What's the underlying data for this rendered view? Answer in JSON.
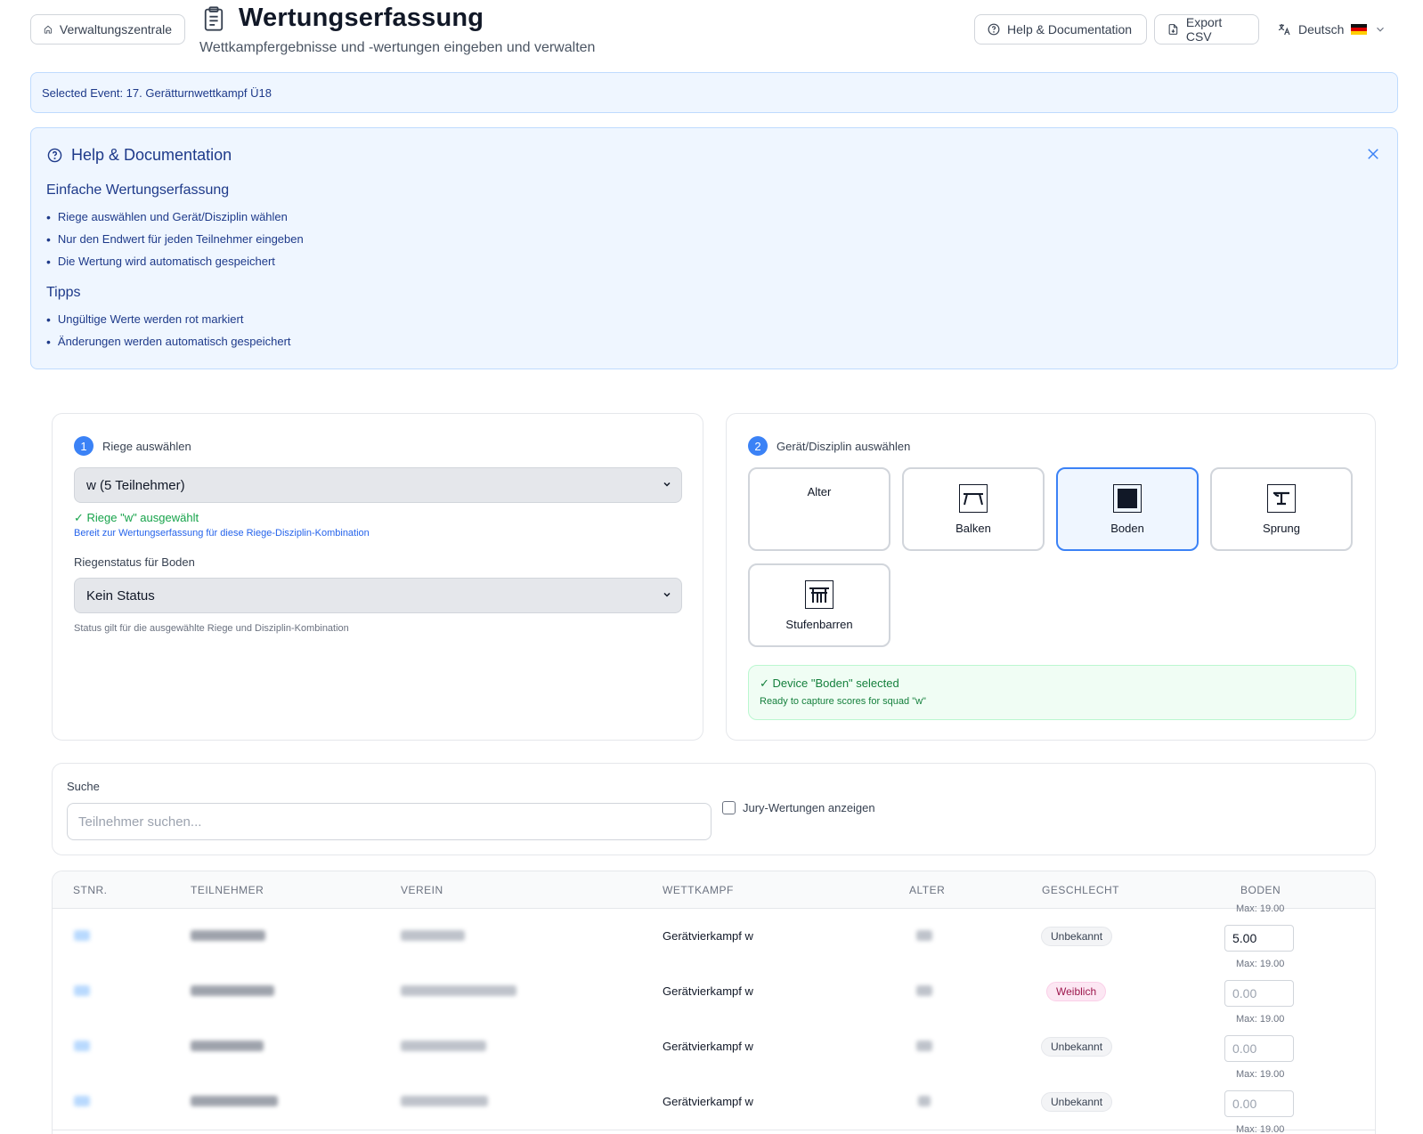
{
  "header": {
    "home_button": "Verwaltungszentrale",
    "title": "Wertungserfassung",
    "subtitle": "Wettkampfergebnisse und -wertungen eingeben und verwalten",
    "help_button": "Help & Documentation",
    "export_button": "Export CSV",
    "language": "Deutsch"
  },
  "event_banner": "Selected Event: 17. Gerätturnwettkampf Ü18",
  "help_panel": {
    "title": "Help & Documentation",
    "section1_title": "Einfache Wertungserfassung",
    "section1_items": [
      "Riege auswählen und Gerät/Disziplin wählen",
      "Nur den Endwert für jeden Teilnehmer eingeben",
      "Die Wertung wird automatisch gespeichert"
    ],
    "section2_title": "Tipps",
    "section2_items": [
      "Ungültige Werte werden rot markiert",
      "Änderungen werden automatisch gespeichert"
    ]
  },
  "squad_card": {
    "step_number": "1",
    "step_label": "Riege auswählen",
    "squad_select_value": "w (5 Teilnehmer)",
    "squad_selected_msg": "✓ Riege \"w\" ausgewählt",
    "squad_ready_msg": "Bereit zur Wertungserfassung für diese Riege-Disziplin-Kombination",
    "status_label": "Riegenstatus für Boden",
    "status_select_value": "Kein Status",
    "status_note": "Status gilt für die ausgewählte Riege und Disziplin-Kombination"
  },
  "device_card": {
    "step_number": "2",
    "step_label": "Gerät/Disziplin auswählen",
    "devices": [
      {
        "label": "Alter",
        "icon": "none"
      },
      {
        "label": "Balken",
        "icon": "balance-beam-icon"
      },
      {
        "label": "Boden",
        "icon": "floor-icon",
        "selected": true
      },
      {
        "label": "Sprung",
        "icon": "vault-icon"
      },
      {
        "label": "Stufenbarren",
        "icon": "uneven-bars-icon"
      }
    ],
    "success_title": "✓ Device \"Boden\" selected",
    "success_sub": "Ready to capture scores for squad \"w\""
  },
  "search": {
    "label": "Suche",
    "placeholder": "Teilnehmer suchen...",
    "jury_label": "Jury-Wertungen anzeigen"
  },
  "table": {
    "columns": [
      "STNR.",
      "TEILNEHMER",
      "VEREIN",
      "WETTKAMPF",
      "ALTER",
      "GESCHLECHT",
      "BODEN"
    ],
    "max_label": "Max: 19.00",
    "score_placeholder": "0.00",
    "rows": [
      {
        "competition": "Gerätvierkampf w",
        "gender": "Unbekannt",
        "score": "5.00"
      },
      {
        "competition": "Gerätvierkampf w",
        "gender": "Weiblich",
        "score": ""
      },
      {
        "competition": "Gerätvierkampf w",
        "gender": "Unbekannt",
        "score": ""
      },
      {
        "competition": "Gerätvierkampf w",
        "gender": "Unbekannt",
        "score": ""
      }
    ]
  },
  "colors": {
    "accent": "#3b82f6",
    "info_bg": "#eff6ff",
    "success": "#16a34a",
    "female_badge": "#fce7f3"
  }
}
